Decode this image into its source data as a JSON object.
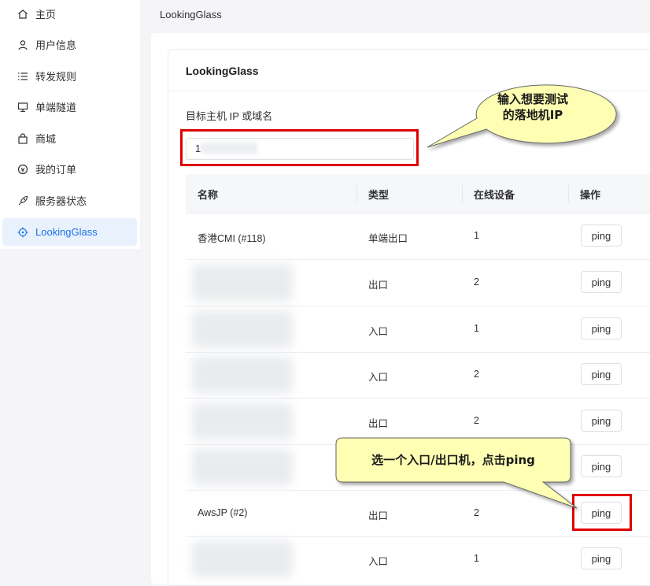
{
  "sidebar": {
    "items": [
      {
        "label": "主页",
        "icon": "home-icon"
      },
      {
        "label": "用户信息",
        "icon": "user-icon"
      },
      {
        "label": "转发规则",
        "icon": "list-icon"
      },
      {
        "label": "单端隧道",
        "icon": "monitor-icon"
      },
      {
        "label": "商城",
        "icon": "shopping-bag-icon"
      },
      {
        "label": "我的订单",
        "icon": "order-icon"
      },
      {
        "label": "服务器状态",
        "icon": "rocket-icon"
      },
      {
        "label": "LookingGlass",
        "icon": "target-icon",
        "active": true
      }
    ]
  },
  "breadcrumb": "LookingGlass",
  "card": {
    "title": "LookingGlass",
    "field_label": "目标主机 IP 或域名",
    "input_value": "1"
  },
  "table": {
    "headers": [
      "名称",
      "类型",
      "在线设备",
      "操作"
    ],
    "rows": [
      {
        "name": "香港CMI (#118)",
        "type": "单端出口",
        "online": "1",
        "action": "ping"
      },
      {
        "name": "",
        "type": "出口",
        "online": "2",
        "action": "ping"
      },
      {
        "name": "",
        "type": "入口",
        "online": "1",
        "action": "ping"
      },
      {
        "name": "",
        "type": "入口",
        "online": "2",
        "action": "ping"
      },
      {
        "name": "",
        "type": "出口",
        "online": "2",
        "action": "ping"
      },
      {
        "name": "",
        "type": "",
        "online": "",
        "action": "ping"
      },
      {
        "name": "AwsJP (#2)",
        "type": "出口",
        "online": "2",
        "action": "ping"
      },
      {
        "name": "",
        "type": "入口",
        "online": "1",
        "action": "ping"
      }
    ]
  },
  "callouts": {
    "top_line1": "输入想要测试",
    "top_line2": "的落地机IP",
    "bottom": "选一个入口/出口机，点击ping"
  },
  "colors": {
    "accent": "#1a73e8",
    "highlight": "#e00000",
    "callout_fill": "#ffffb3"
  }
}
